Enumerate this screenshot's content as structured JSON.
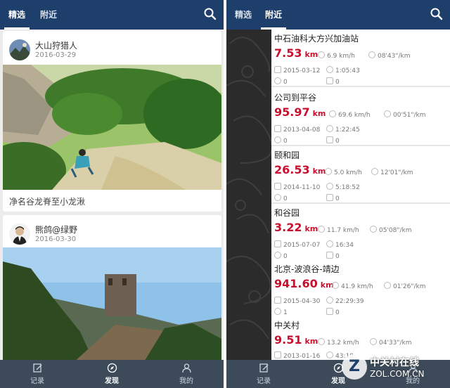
{
  "left": {
    "tabs": [
      {
        "label": "精选",
        "active": true
      },
      {
        "label": "附近",
        "active": false
      }
    ],
    "posts": [
      {
        "author": "大山狩猎人",
        "date": "2016-03-29",
        "caption": "净名谷龙脊至小龙湫"
      },
      {
        "author": "熊鸽@绿野",
        "date": "2016-03-30"
      }
    ],
    "nav": [
      {
        "label": "记录",
        "icon": "edit-icon"
      },
      {
        "label": "发现",
        "icon": "compass-icon",
        "active": true
      },
      {
        "label": "我的",
        "icon": "user-icon"
      }
    ]
  },
  "right": {
    "tabs": [
      {
        "label": "精选",
        "active": false
      },
      {
        "label": "附近",
        "active": true
      }
    ],
    "routes": [
      {
        "name": "中石油科大方兴加油站",
        "distance": "7.53",
        "unit": "km",
        "speed": "6.9 km/h",
        "pace": "08'43\"/km",
        "date": "2015-03-12",
        "duration": "1:05:43",
        "likes": "0",
        "comments": "0"
      },
      {
        "name": "公司到平谷",
        "distance": "95.97",
        "unit": "km",
        "speed": "69.6 km/h",
        "pace": "00'51\"/km",
        "date": "2013-04-08",
        "duration": "1:22:45",
        "likes": "0",
        "comments": "0"
      },
      {
        "name": "颐和园",
        "distance": "26.53",
        "unit": "km",
        "speed": "5.0 km/h",
        "pace": "12'01\"/km",
        "date": "2014-11-10",
        "duration": "5:18:52",
        "likes": "0",
        "comments": "0"
      },
      {
        "name": "和谷园",
        "distance": "3.22",
        "unit": "km",
        "speed": "11.7 km/h",
        "pace": "05'08\"/km",
        "date": "2015-07-07",
        "duration": "16:34",
        "likes": "0",
        "comments": "0"
      },
      {
        "name": "北京-波浪谷-靖边",
        "distance": "941.60",
        "unit": "km",
        "speed": "41.9 km/h",
        "pace": "01'26\"/km",
        "date": "2015-04-30",
        "duration": "22:29:39",
        "likes": "1",
        "comments": "0"
      },
      {
        "name": "中关村",
        "distance": "9.51",
        "unit": "km",
        "speed": "13.2 km/h",
        "pace": "04'33\"/km",
        "date": "2013-01-16",
        "duration": "43:19"
      }
    ],
    "nav": [
      {
        "label": "记录",
        "icon": "edit-icon"
      },
      {
        "label": "发现",
        "icon": "compass-icon",
        "active": true
      },
      {
        "label": "我的",
        "icon": "user-icon"
      }
    ]
  },
  "watermark": {
    "brand": "中关村在线",
    "site": "ZOL.COM.CN",
    "logo_letter": "Z"
  },
  "colors": {
    "header": "#1e3e6b",
    "nav": "#3c4a5a",
    "distance": "#c8102e"
  }
}
